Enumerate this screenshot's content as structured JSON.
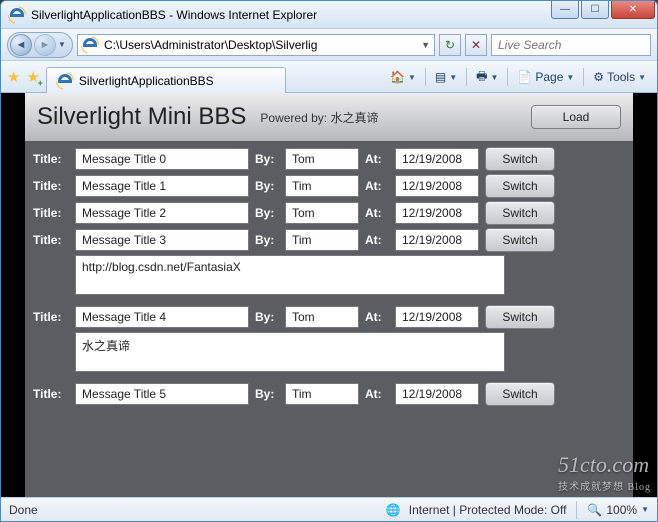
{
  "window": {
    "title": "SilverlightApplicationBBS - Windows Internet Explorer"
  },
  "nav": {
    "address": "C:\\Users\\Administrator\\Desktop\\Silverlig",
    "refresh_glyph": "↻",
    "stop_glyph": "✕",
    "search_placeholder": "Live Search"
  },
  "tab": {
    "label": "SilverlightApplicationBBS"
  },
  "cmdbar": {
    "page": "Page",
    "tools": "Tools"
  },
  "bbs": {
    "title": "Silverlight Mini BBS",
    "subtitle": "Powered by: 水之真谛",
    "load": "Load",
    "labels": {
      "title": "Title:",
      "by": "By:",
      "at": "At:"
    },
    "switch": "Switch",
    "rows": [
      {
        "title": "Message Title 0",
        "by": "Tom",
        "at": "12/19/2008",
        "expanded": false
      },
      {
        "title": "Message Title 1",
        "by": "Tim",
        "at": "12/19/2008",
        "expanded": false
      },
      {
        "title": "Message Title 2",
        "by": "Tom",
        "at": "12/19/2008",
        "expanded": false
      },
      {
        "title": "Message Title 3",
        "by": "Tim",
        "at": "12/19/2008",
        "expanded": true,
        "body": "http://blog.csdn.net/FantasiaX"
      },
      {
        "title": "Message Title 4",
        "by": "Tom",
        "at": "12/19/2008",
        "expanded": true,
        "body": "水之真谛"
      },
      {
        "title": "Message Title 5",
        "by": "Tim",
        "at": "12/19/2008",
        "expanded": false
      }
    ]
  },
  "status": {
    "left": "Done",
    "zone": "Internet | Protected Mode: Off",
    "zoom": "100%"
  },
  "watermark": {
    "brand": "51cto.com",
    "sub": "技术成就梦想 Blog"
  }
}
